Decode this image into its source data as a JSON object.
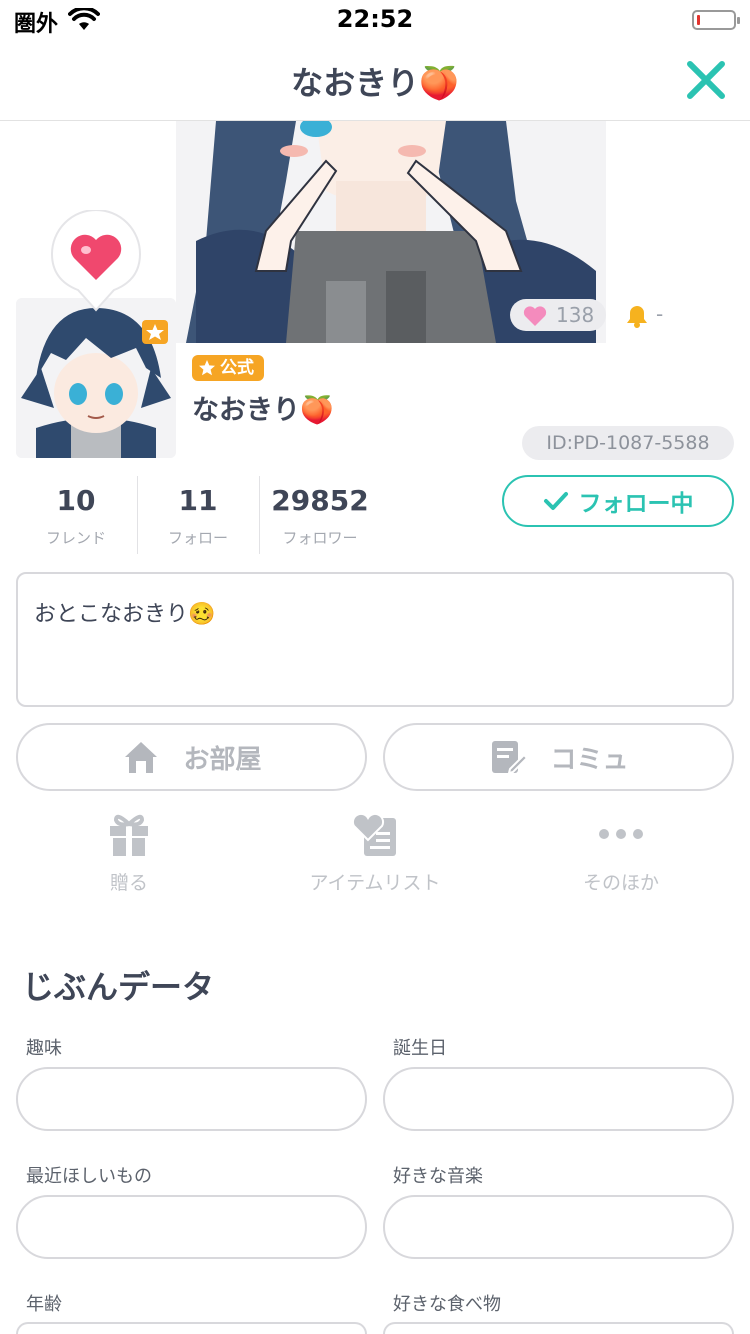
{
  "status_bar": {
    "carrier": "圏外",
    "time": "22:52"
  },
  "nav": {
    "title": "なおきり🍑"
  },
  "banner": {
    "likes": "138",
    "bell_value": "-"
  },
  "profile": {
    "badge": "公式",
    "name": "なおきり🍑",
    "user_id": "ID:PD-1087-5588"
  },
  "stats": [
    {
      "value": "10",
      "label": "フレンド"
    },
    {
      "value": "11",
      "label": "フォロー"
    },
    {
      "value": "29852",
      "label": "フォロワー"
    }
  ],
  "follow_button": "フォロー中",
  "bio": "おとこなおきり🥴",
  "actions": {
    "room": "お部屋",
    "community": "コミュ"
  },
  "mini_actions": [
    {
      "label": "贈る",
      "icon": "gift-icon"
    },
    {
      "label": "アイテムリスト",
      "icon": "item-list-icon"
    },
    {
      "label": "そのほか",
      "icon": "more-icon"
    }
  ],
  "section": {
    "title": "じぶんデータ"
  },
  "fields": [
    {
      "label": "趣味"
    },
    {
      "label": "誕生日"
    },
    {
      "label": "最近ほしいもの"
    },
    {
      "label": "好きな音楽"
    },
    {
      "label": "年齢"
    },
    {
      "label": "好きな食べ物"
    }
  ],
  "colors": {
    "accent": "#2bc3b2",
    "badge": "#f6a524",
    "text": "#3f4657",
    "muted": "#b4b7bd"
  }
}
